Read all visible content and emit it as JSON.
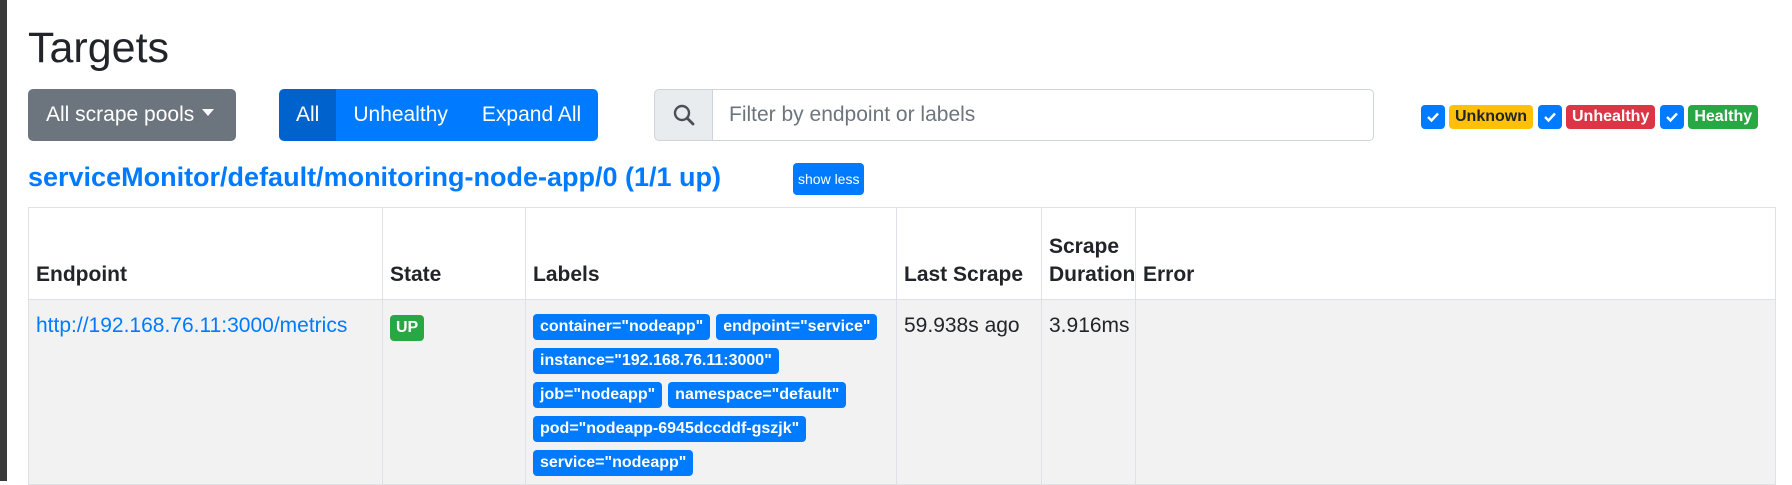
{
  "page": {
    "title": "Targets"
  },
  "toolbar": {
    "pool_dropdown_label": "All scrape pools",
    "filter_buttons": {
      "all": "All",
      "unhealthy": "Unhealthy",
      "expand_all": "Expand All"
    },
    "search": {
      "placeholder": "Filter by endpoint or labels",
      "value": "",
      "icon": "search-icon"
    }
  },
  "health_filters": {
    "unknown": {
      "label": "Unknown",
      "checked": true,
      "color": "#ffc107"
    },
    "unhealthy": {
      "label": "Unhealthy",
      "checked": true,
      "color": "#dc3545"
    },
    "healthy": {
      "label": "Healthy",
      "checked": true,
      "color": "#28a745"
    }
  },
  "pool": {
    "title": "serviceMonitor/default/monitoring-node-app/0 (1/1 up)",
    "toggle_label": "show less"
  },
  "table": {
    "headers": {
      "endpoint": "Endpoint",
      "state": "State",
      "labels": "Labels",
      "last_scrape": "Last Scrape",
      "scrape_duration": "Scrape Duration",
      "error": "Error"
    },
    "rows": [
      {
        "endpoint": "http://192.168.76.11:3000/metrics",
        "state": "UP",
        "labels": [
          "container=\"nodeapp\"",
          "endpoint=\"service\"",
          "instance=\"192.168.76.11:3000\"",
          "job=\"nodeapp\"",
          "namespace=\"default\"",
          "pod=\"nodeapp-6945dccddf-gszjk\"",
          "service=\"nodeapp\""
        ],
        "last_scrape": "59.938s ago",
        "scrape_duration": "3.916ms",
        "error": ""
      }
    ]
  }
}
